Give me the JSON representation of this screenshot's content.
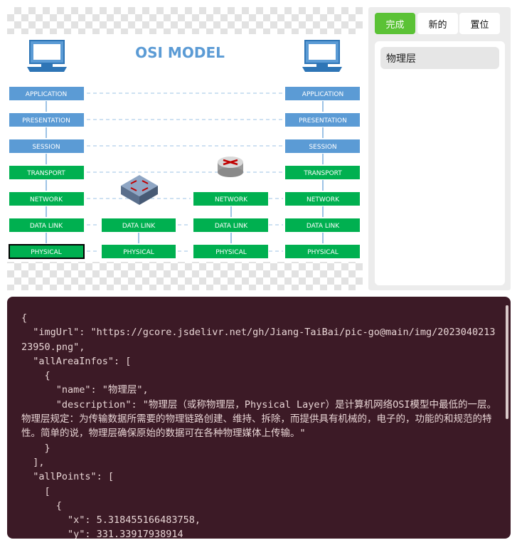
{
  "diagram": {
    "title": "OSI MODEL",
    "layers_left": [
      "APPLICATION",
      "PRESENTATION",
      "SESSION",
      "TRANSPORT",
      "NETWORK",
      "DATA LINK",
      "PHYSICAL"
    ],
    "layers_right": [
      "APPLICATION",
      "PRESENTATION",
      "SESSION",
      "TRANSPORT",
      "NETWORK",
      "DATA LINK",
      "PHYSICAL"
    ],
    "switch_column": [
      "DATA LINK",
      "PHYSICAL"
    ],
    "router_column": [
      "NETWORK",
      "DATA LINK",
      "PHYSICAL"
    ],
    "colors": {
      "upper": "#5b9bd5",
      "lower": "#00b050",
      "selected_border": "#000000"
    }
  },
  "toolbar": {
    "done_label": "完成",
    "new_label": "新的",
    "reset_label": "置位"
  },
  "areas": {
    "items": [
      "物理层"
    ]
  },
  "json_view": {
    "text": "{\n  \"imgUrl\": \"https://gcore.jsdelivr.net/gh/Jiang-TaiBai/pic-go@main/img/202304021323950.png\",\n  \"allAreaInfos\": [\n    {\n      \"name\": \"物理层\",\n      \"description\": \"物理层（或称物理层，Physical Layer）是计算机网络OSI模型中最低的一层。物理层规定：为传输数据所需要的物理链路创建、维持、拆除，而提供具有机械的，电子的，功能的和规范的特性。简单的说，物理层确保原始的数据可在各种物理媒体上传输。\"\n    }\n  ],\n  \"allPoints\": [\n    [\n      {\n        \"x\": 5.318455166483758,\n        \"y\": 331.33917938914"
  }
}
